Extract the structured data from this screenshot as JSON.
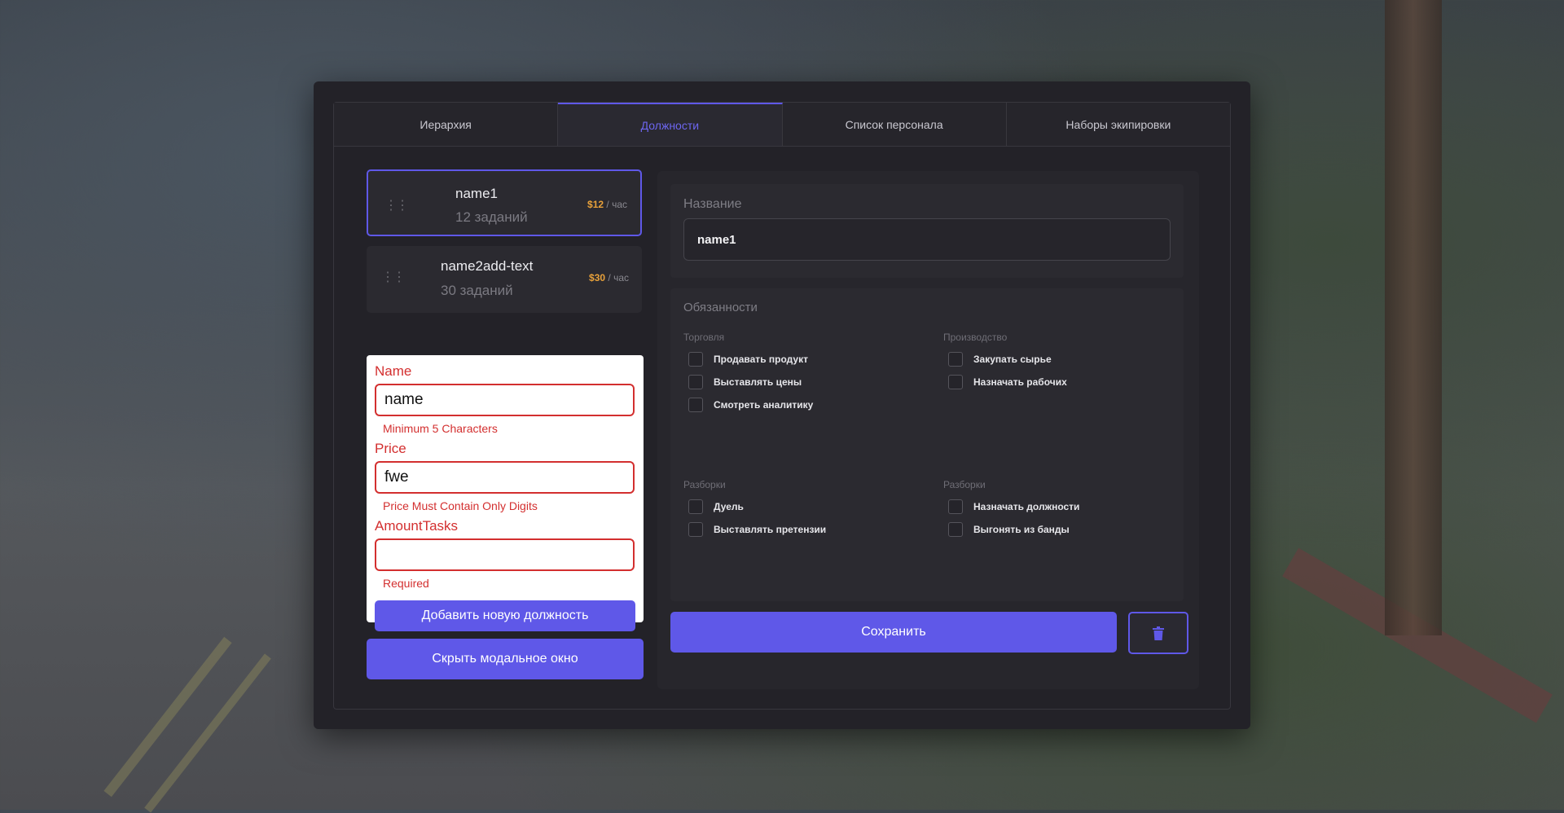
{
  "tabs": [
    {
      "label": "Иерархия",
      "active": false
    },
    {
      "label": "Должности",
      "active": true
    },
    {
      "label": "Список персонала",
      "active": false
    },
    {
      "label": "Наборы экипировки",
      "active": false
    }
  ],
  "positions": [
    {
      "name": "name1",
      "tasks": "12 заданий",
      "price": "$12",
      "per": "/ час",
      "selected": true
    },
    {
      "name": "name2add-text",
      "tasks": "30 заданий",
      "price": "$30",
      "per": "/ час",
      "selected": false
    }
  ],
  "add_form": {
    "name_label": "Name",
    "name_value": "name",
    "name_error": "Minimum 5 Characters",
    "price_label": "Price",
    "price_value": "fwe",
    "price_error": "Price Must Contain Only Digits",
    "tasks_label": "AmountTasks",
    "tasks_value": "",
    "tasks_error": "Required",
    "submit_label": "Добавить новую должность"
  },
  "hide_modal_label": "Скрыть модальное окно",
  "detail": {
    "name_label": "Название",
    "name_value": "name1",
    "duties_title": "Обязанности",
    "groups": [
      {
        "title": "Торговля",
        "items": [
          "Продавать продукт",
          "Выставлять цены",
          "Смотреть аналитику"
        ]
      },
      {
        "title": "Производство",
        "items": [
          "Закупать сырье",
          "Назначать рабочих"
        ]
      },
      {
        "title": "Разборки",
        "items": [
          "Дуель",
          "Выставлять претензии"
        ]
      },
      {
        "title": "Разборки",
        "items": [
          "Назначать должности",
          "Выгонять из банды"
        ]
      }
    ],
    "save_label": "Сохранить",
    "delete_icon": "trash-icon"
  },
  "colors": {
    "accent": "#5f58e8",
    "price": "#e8a13a",
    "error": "#d32f2f",
    "modal_bg": "#232228"
  }
}
